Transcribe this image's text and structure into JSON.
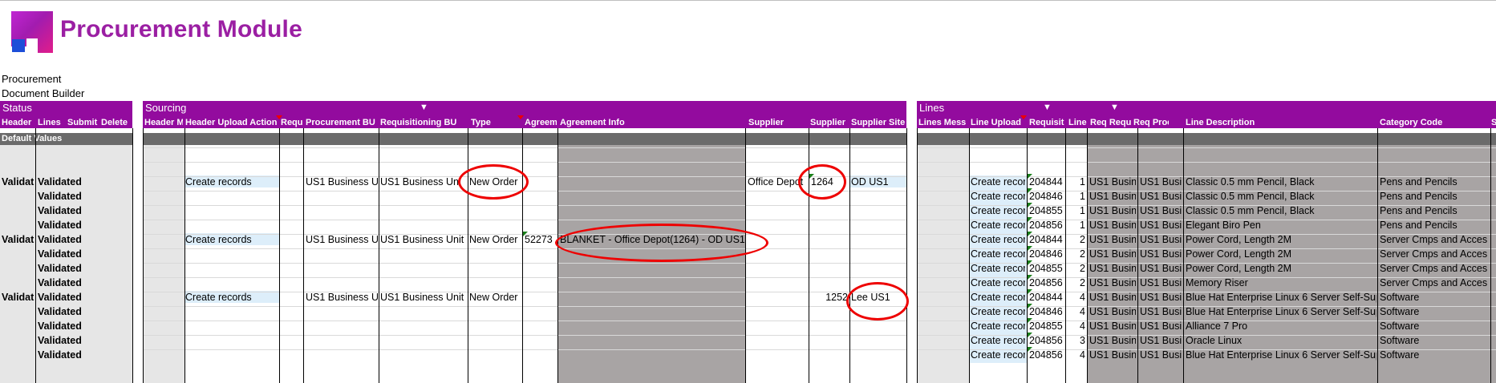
{
  "app": {
    "title": "Procurement Module",
    "sub1": "Procurement",
    "sub2": "Document Builder"
  },
  "bands": {
    "status": {
      "title": "Status",
      "cols": [
        "Header",
        "Lines",
        "Submit",
        "Delete"
      ]
    },
    "sourcing": {
      "title": "Sourcing",
      "cols": [
        "Header M",
        "Header Upload Action",
        "Requ",
        "Procurement BU",
        "Requisitioning BU",
        "Type",
        "Agreem",
        "Agreement Info",
        "Supplier",
        "Supplier",
        "Supplier Site"
      ]
    },
    "lines": {
      "title": "Lines",
      "cols": [
        "Lines Mess",
        "Line Upload",
        "Requisit",
        "Line",
        "Req Requis",
        "Req Proc",
        "Line Description",
        "Category Code",
        "S"
      ]
    }
  },
  "default_values_label": "Default Values",
  "status_rows": [
    [
      "Validat",
      "Validated"
    ],
    [
      "",
      "Validated"
    ],
    [
      "",
      "Validated"
    ],
    [
      "",
      "Validated"
    ],
    [
      "Validat",
      "Validated"
    ],
    [
      "",
      "Validated"
    ],
    [
      "",
      "Validated"
    ],
    [
      "",
      "Validated"
    ],
    [
      "Validat",
      "Validated"
    ],
    [
      "",
      "Validated"
    ],
    [
      "",
      "Validated"
    ],
    [
      "",
      "Validated"
    ],
    [
      "",
      "Validated"
    ]
  ],
  "sourcing_rows": [
    {
      "action": "Create records",
      "proc_bu": "US1 Business Un",
      "req_bu": "US1 Business Uni",
      "type": "New Order",
      "agreement": "",
      "agreement_info": "",
      "supplier": "Office Depot",
      "supplier_num": "1264",
      "site": "OD US1"
    },
    {
      "action": "Create records",
      "proc_bu": "US1 Business Un",
      "req_bu": "US1 Business Unit",
      "type": "New Order",
      "agreement": "52273",
      "agreement_info": "BLANKET - Office Depot(1264) - OD US1",
      "supplier": "",
      "supplier_num": "",
      "site": ""
    },
    {
      "action": "Create records",
      "proc_bu": "US1 Business Un",
      "req_bu": "US1 Business Unit",
      "type": "New Order",
      "agreement": "",
      "agreement_info": "",
      "supplier": "",
      "supplier_num": "1252",
      "site": "Lee US1"
    }
  ],
  "line_rows": [
    {
      "upload": "Create recor",
      "req": "204844",
      "line": "1",
      "rr": "US1 Busine",
      "rp": "US1 Busin",
      "desc": "Classic 0.5 mm Pencil, Black",
      "cat": "Pens and Pencils"
    },
    {
      "upload": "Create recor",
      "req": "204846",
      "line": "1",
      "rr": "US1 Busine",
      "rp": "US1 Busin",
      "desc": "Classic 0.5 mm Pencil, Black",
      "cat": "Pens and Pencils"
    },
    {
      "upload": "Create recor",
      "req": "204855",
      "line": "1",
      "rr": "US1 Busine",
      "rp": "US1 Busin",
      "desc": "Classic 0.5 mm Pencil, Black",
      "cat": "Pens and Pencils"
    },
    {
      "upload": "Create recor",
      "req": "204856",
      "line": "1",
      "rr": "US1 Busine",
      "rp": "US1 Busin",
      "desc": "Elegant Biro Pen",
      "cat": "Pens and Pencils"
    },
    {
      "upload": "Create recor",
      "req": "204844",
      "line": "2",
      "rr": "US1 Busine",
      "rp": "US1 Busin",
      "desc": "Power Cord, Length 2M",
      "cat": "Server Cmps and Acces"
    },
    {
      "upload": "Create recor",
      "req": "204846",
      "line": "2",
      "rr": "US1 Busine",
      "rp": "US1 Busin",
      "desc": "Power Cord, Length 2M",
      "cat": "Server Cmps and Acces"
    },
    {
      "upload": "Create recor",
      "req": "204855",
      "line": "2",
      "rr": "US1 Busine",
      "rp": "US1 Busin",
      "desc": "Power Cord, Length 2M",
      "cat": "Server Cmps and Acces"
    },
    {
      "upload": "Create recor",
      "req": "204856",
      "line": "2",
      "rr": "US1 Busine",
      "rp": "US1 Busin",
      "desc": "Memory Riser",
      "cat": "Server Cmps and Acces"
    },
    {
      "upload": "Create recor",
      "req": "204844",
      "line": "4",
      "rr": "US1 Busine",
      "rp": "US1 Busin",
      "desc": "Blue Hat Enterprise Linux 6 Server Self-Sup",
      "cat": "Software"
    },
    {
      "upload": "Create recor",
      "req": "204846",
      "line": "4",
      "rr": "US1 Busine",
      "rp": "US1 Busin",
      "desc": "Blue Hat Enterprise Linux 6 Server Self-Sup",
      "cat": "Software"
    },
    {
      "upload": "Create recor",
      "req": "204855",
      "line": "4",
      "rr": "US1 Busine",
      "rp": "US1 Busin",
      "desc": "Alliance 7 Pro",
      "cat": "Software"
    },
    {
      "upload": "Create recor",
      "req": "204856",
      "line": "3",
      "rr": "US1 Busine",
      "rp": "US1 Busin",
      "desc": "Oracle Linux",
      "cat": "Software"
    },
    {
      "upload": "Create recor",
      "req": "204856",
      "line": "4",
      "rr": "US1 Busine",
      "rp": "US1 Busin",
      "desc": "Blue Hat Enterprise Linux 6 Server Self-Sup",
      "cat": "Software"
    }
  ],
  "colors": {
    "band": "#930b9e",
    "title": "#9b1fa3",
    "annotation": "#e00000"
  }
}
